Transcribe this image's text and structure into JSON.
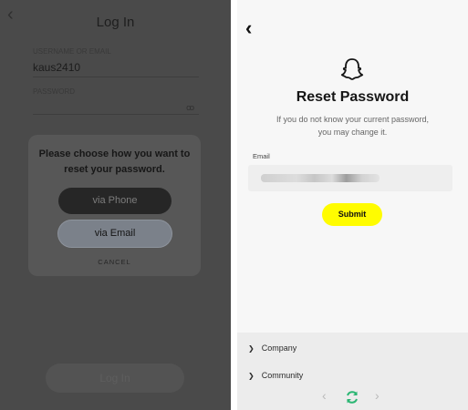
{
  "left": {
    "back_icon": "chevron-left-icon",
    "title": "Log In",
    "username_label": "USERNAME OR EMAIL",
    "username_value": "kaus2410",
    "password_label": "PASSWORD",
    "password_toggle": "eye-icon",
    "login_button_label": "Log In",
    "modal": {
      "prompt": "Please choose how you want to reset your password.",
      "phone_option": "via Phone",
      "email_option": "via Email",
      "cancel_label": "CANCEL"
    }
  },
  "right": {
    "back_icon": "chevron-left-icon",
    "logo_icon": "ghost-icon",
    "heading": "Reset Password",
    "description_line1": "If you do not know your current password,",
    "description_line2": "you may change it.",
    "email_label": "Email",
    "submit_label": "Submit",
    "footer_items": [
      "Company",
      "Community"
    ],
    "accent_color": "#FFFC00"
  }
}
